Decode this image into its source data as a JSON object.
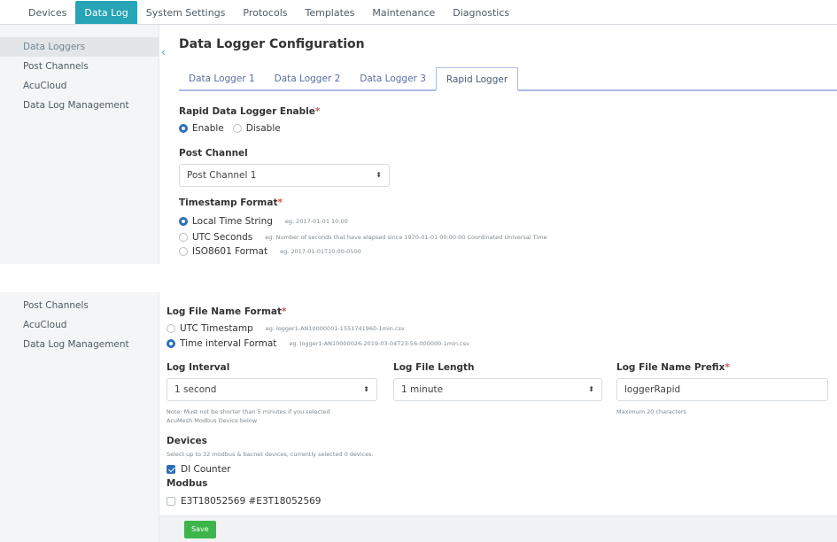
{
  "nav": {
    "tabs": [
      "Devices",
      "Data Log",
      "System Settings",
      "Protocols",
      "Templates",
      "Maintenance",
      "Diagnostics"
    ],
    "active": "Data Log"
  },
  "panel1": {
    "sidebar": [
      "Data Loggers",
      "Post Channels",
      "AcuCloud",
      "Data Log Management"
    ],
    "collapse_glyph": "‹",
    "title": "Data Logger Configuration",
    "logger_tabs": [
      "Data Logger 1",
      "Data Logger 2",
      "Data Logger 3",
      "Rapid Logger"
    ],
    "enable_label": "Rapid Data Logger Enable",
    "required_mark": "*",
    "enable_options": [
      "Enable",
      "Disable"
    ],
    "post_channel_label": "Post Channel",
    "post_channel_value": "Post Channel 1",
    "timestamp_label": "Timestamp Format",
    "timestamp_options": [
      {
        "label": "Local Time String",
        "eg": "eg. 2017-01-01 10:00"
      },
      {
        "label": "UTC Seconds",
        "eg": "eg. Number of seconds that have elapsed since 1970-01-01 00:00:00 Coordinated Universal Time"
      },
      {
        "label": "ISO8601 Format",
        "eg": "eg. 2017-01-01T10:00-0500"
      }
    ]
  },
  "panel2": {
    "sidebar": [
      "Post Channels",
      "AcuCloud",
      "Data Log Management"
    ],
    "log_file_name_format_label": "Log File Name Format",
    "log_file_name_options": [
      {
        "label": "UTC Timestamp",
        "eg": "eg. logger1-AN10000001-1551741960-1min.csv"
      },
      {
        "label": "Time interval Format",
        "eg": "eg. logger1-AN10000026-2019-03-04T23-56-000000-1min.csv"
      }
    ],
    "log_interval_label": "Log Interval",
    "log_interval_value": "1 second",
    "log_interval_note_1": "Note: Must not be shorter than 5 minutes if you selected",
    "log_interval_note_2": "AcuMesh Modbus Device below",
    "log_file_length_label": "Log File Length",
    "log_file_length_value": "1 minute",
    "prefix_label": "Log File Name Prefix",
    "prefix_value": "loggerRapid",
    "prefix_note": "Maximum 20 characters",
    "devices_label": "Devices",
    "devices_note": "Select up to 32 modbus & bacnet devices, currently selected 0 devices.",
    "di_counter_label": "DI Counter",
    "modbus_label": "Modbus",
    "modbus_device": "E3T18052569 #E3T18052569",
    "save_label": "Save",
    "select_arrow": "⬍"
  }
}
